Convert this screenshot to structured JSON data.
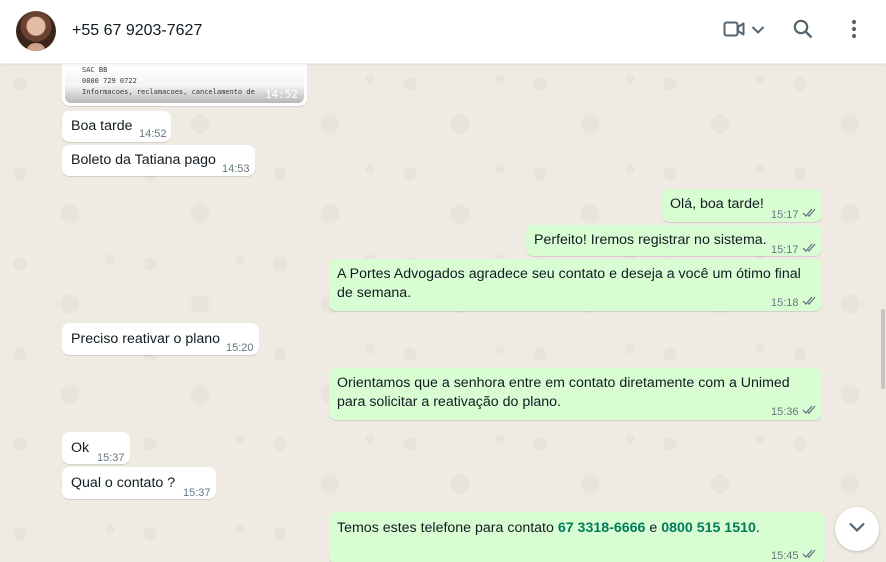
{
  "contact": {
    "name": "+55 67 9203-7627"
  },
  "header": {
    "video_icon": "video-camera-icon",
    "chevron_icon": "chevron-down-icon",
    "search_icon": "search-icon",
    "menu_icon": "kebab-menu-icon"
  },
  "image_message": {
    "lines": [
      "SAC BB",
      "0800 729 0722",
      "Informacoes, reclamacoes, cancelamento de"
    ],
    "time": "14:52"
  },
  "messages": [
    {
      "dir": "in",
      "text": "Boa tarde",
      "time": "14:52"
    },
    {
      "dir": "in",
      "text": "Boleto da Tatiana pago",
      "time": "14:53"
    },
    {
      "dir": "out",
      "text": "Olá, boa tarde!",
      "time": "15:17"
    },
    {
      "dir": "out",
      "text": "Perfeito! Iremos registrar no sistema.",
      "time": "15:17"
    },
    {
      "dir": "out",
      "line1": "A Portes Advogados agradece seu contato e deseja a você um ótimo final",
      "line2": "de semana.",
      "time": "15:18"
    },
    {
      "dir": "in",
      "text": "Preciso reativar o plano",
      "time": "15:20"
    },
    {
      "dir": "out",
      "line1": "Orientamos que a senhora entre em contato diretamente com a Unimed",
      "line2": "para solicitar a reativação do plano.",
      "time": "15:36"
    },
    {
      "dir": "in",
      "text": "Ok",
      "time": "15:37"
    },
    {
      "dir": "in",
      "text": "Qual o contato ?",
      "time": "15:37"
    },
    {
      "dir": "out",
      "prefix": "Temos estes telefone para contato ",
      "phone1": "67 3318-6666",
      "mid": " e ",
      "phone2": "0800 515 1510",
      "suffix": ".",
      "time": "15:45"
    }
  ],
  "colors": {
    "incoming": "#ffffff",
    "outgoing": "#d9fdd3",
    "tick": "#667781",
    "phone": "#027b5b"
  }
}
